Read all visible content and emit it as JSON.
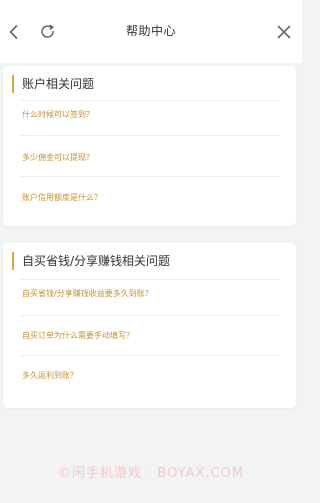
{
  "header": {
    "title": "帮助中心",
    "icons": {
      "back": "chevron-left-icon",
      "refresh": "refresh-icon",
      "close": "close-icon"
    }
  },
  "sections": [
    {
      "title": "账户相关问题",
      "questions": [
        "什么时候可以签到？",
        "多少佣金可以提现？",
        "账户信用额度是什么？"
      ]
    },
    {
      "title": "自买省钱/分享赚钱相关问题",
      "questions": [
        "自买省钱/分享赚钱收益要多久到账？",
        "自买订单为什么需要手动填写？",
        "多久返利到账？"
      ]
    }
  ],
  "watermark": "©闲手机游戏 · BOYAX.COM",
  "colors": {
    "accent": "#e0a83a",
    "question_text": "#c89030",
    "background": "#f3f3f3"
  }
}
